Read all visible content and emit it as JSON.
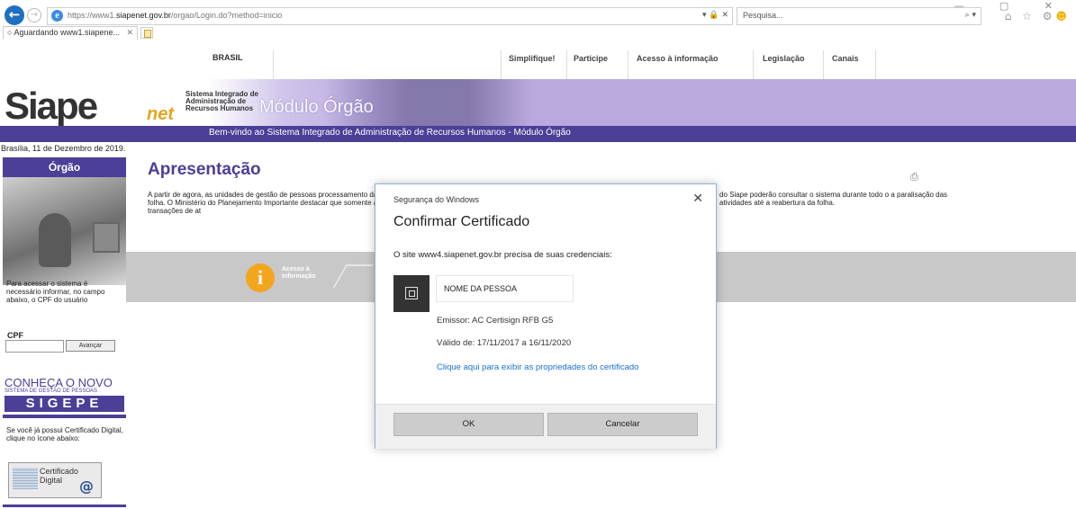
{
  "browser": {
    "url_prefix": "https://www1.",
    "url_domain": "siapenet.gov.br",
    "url_path": "/orgao/Login.do?method=inicio",
    "address_actions": "▾ 🔒 ✕",
    "search_placeholder": "Pesquisa...",
    "tab_title": "Aguardando www1.siapene...",
    "tab_close": "✕",
    "window_controls": "— ▢ ✕",
    "toolbar_icons": "⌂ ☆ ⚙"
  },
  "header": {
    "gov_brasil": "BRASIL",
    "gov_links": [
      "Simplifique!",
      "Participe",
      "Acesso à informação",
      "Legislação",
      "Canais"
    ],
    "logo_text": "Siape",
    "logo_net": "net",
    "logo_subtitle": "Sistema Integrado de\nAdministração de\nRecursos Humanos",
    "module_title": "Módulo Órgão",
    "welcome": "Bem-vindo ao Sistema Integrado de Administração de Recursos Humanos - Módulo Órgão"
  },
  "date_line": "Brasília, 11 de Dezembro de 2019.",
  "sidebar": {
    "title": "Órgão",
    "info": "Para acessar o sistema é necessário informar, no campo abaixo, o CPF do usuário",
    "cpf_label": "CPF",
    "cpf_value": "",
    "cpf_button": "Avançar",
    "sigepe_heading": "CONHEÇA O NOVO",
    "sigepe_sub": "SISTEMA DE GESTÃO DE PESSOAS",
    "sigepe_logo": "SIGEPE",
    "cert_info": "Se você já possui Certificado Digital, clique no ícone abaixo:",
    "cert_button": "Certificado\nDigital"
  },
  "main": {
    "heading": "Apresentação",
    "text_left": "A partir de agora, as unidades de gestão de pessoas processamento da folha. O Ministério do Planejamento Importante destacar que somente as transações de at",
    "text_right": "do Siape poderão consultar o sistema durante todo o a paralisação das atividades até a reabertura da folha.",
    "acesso_text": "Acesso à\nInformação"
  },
  "dialog": {
    "source": "Segurança do Windows",
    "close": "✕",
    "title": "Confirmar Certificado",
    "message": "O site www4.siapenet.gov.br precisa de suas credenciais:",
    "cert_name": "NOME DA PESSOA",
    "issuer": "Emissor: AC Certisign RFB G5",
    "validity": "Válido de: 17/11/2017 a 16/11/2020",
    "link": "Clique aqui para exibir as propriedades do certificado",
    "ok_label": "OK",
    "cancel_label": "Cancelar"
  },
  "colors": {
    "brand_purple": "#4b3f98",
    "banner_lavender": "#b9a9de",
    "link_blue": "#1a6fd1",
    "acesso_orange": "#f4a51e"
  }
}
